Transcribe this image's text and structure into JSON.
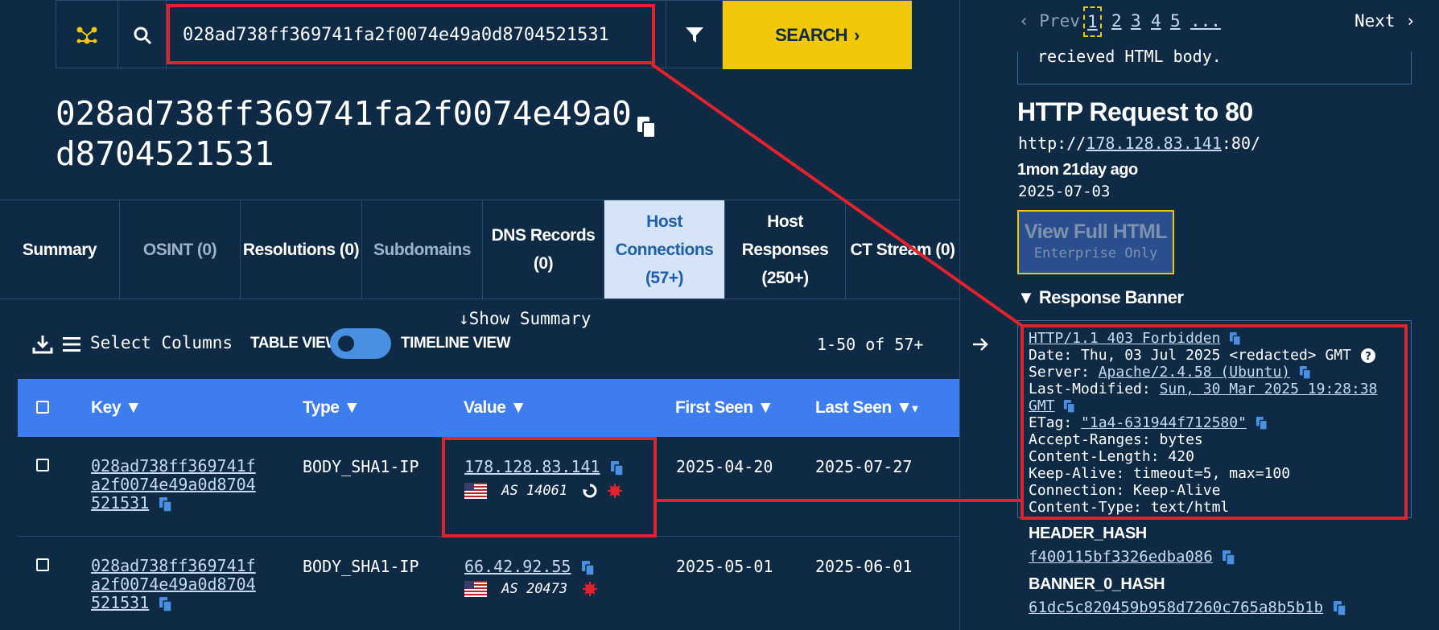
{
  "search": {
    "query": "028ad738ff369741fa2f0074e49a0d8704521531",
    "button_label": "SEARCH"
  },
  "heading": {
    "line1": "028ad738ff369741fa2f0074e49a0",
    "line2": "d8704521531"
  },
  "tabs": [
    {
      "line1": "Summary",
      "line2": ""
    },
    {
      "line1": "OSINT (0)",
      "line2": ""
    },
    {
      "line1": "Resolutions (0)",
      "line2": ""
    },
    {
      "line1": "Subdomains",
      "line2": ""
    },
    {
      "line1": "DNS Records",
      "line2": "(0)"
    },
    {
      "line1": "Host",
      "line2": "Connections",
      "line3": "(57+)"
    },
    {
      "line1": "Host Responses",
      "line2": "(250+)"
    },
    {
      "line1": "CT Stream (0)",
      "line2": ""
    }
  ],
  "toolbar": {
    "show_summary": "Show Summary",
    "select_columns": "Select Columns",
    "table_view": "TABLE VIEW",
    "timeline_view": "TIMELINE VIEW",
    "count": "1-50 of 57+"
  },
  "table": {
    "columns": [
      "Key",
      "Type",
      "Value",
      "First Seen",
      "Last Seen"
    ],
    "rows": [
      {
        "key_l1": "028ad738ff369741f",
        "key_l2": "a2f0074e49a0d8704",
        "key_l3": "521531",
        "type": "BODY_SHA1-IP",
        "value": "178.128.83.141",
        "asn": "AS 14061",
        "first_seen": "2025-04-20",
        "last_seen": "2025-07-27"
      },
      {
        "key_l1": "028ad738ff369741f",
        "key_l2": "a2f0074e49a0d8704",
        "key_l3": "521531",
        "type": "BODY_SHA1-IP",
        "value": "66.42.92.55",
        "asn": "AS 20473",
        "first_seen": "2025-05-01",
        "last_seen": "2025-06-01"
      }
    ]
  },
  "pager": {
    "prev": "‹ Prev",
    "pages": [
      "1",
      "2",
      "3",
      "4",
      "5",
      "..."
    ],
    "next": "Next ›"
  },
  "detail": {
    "cut_text": "recieved HTML body.",
    "title": "HTTP Request to 80",
    "url_prefix": "http://",
    "url_ip": "178.128.83.141",
    "url_suffix": ":80/",
    "age": "1mon 21day ago",
    "date": "2025-07-03",
    "view_full_html": "View Full HTML",
    "enterprise_only": "Enterprise Only",
    "banner_title": "Response Banner",
    "banner": {
      "status": "HTTP/1.1 403 Forbidden",
      "date_line": "Date: Thu, 03 Jul 2025 <redacted> GMT",
      "server_label": "Server: ",
      "server_value": "Apache/2.4.58 (Ubuntu)",
      "lm_label": "Last-Modified: ",
      "lm_value1": "Sun, 30 Mar 2025 19:28:38",
      "lm_value2": "GMT",
      "etag_label": "ETag: ",
      "etag_value": "\"1a4-631944f712580\"",
      "accept_ranges": "Accept-Ranges: bytes",
      "content_length": "Content-Length: 420",
      "keep_alive": "Keep-Alive: timeout=5, max=100",
      "connection": "Connection: Keep-Alive",
      "content_type": "Content-Type: text/html"
    },
    "header_hash_label": "HEADER_HASH",
    "header_hash_value": "f400115bf3326edba086",
    "banner0_hash_label": "BANNER_0_HASH",
    "banner0_hash_value": "61dc5c820459b958d7260c765a8b5b1b"
  },
  "colors": {
    "background": "#0e2a45",
    "accent_yellow": "#f0c808",
    "table_header": "#3d7df0",
    "highlight_red": "#e3222b",
    "active_tab": "#d6e4f7"
  },
  "icons": [
    "network-icon",
    "search-icon",
    "filter-icon",
    "copy-icon",
    "download-icon",
    "list-icon",
    "arrow-right-icon",
    "us-flag-icon",
    "refresh-icon",
    "bug-icon",
    "help-icon"
  ]
}
